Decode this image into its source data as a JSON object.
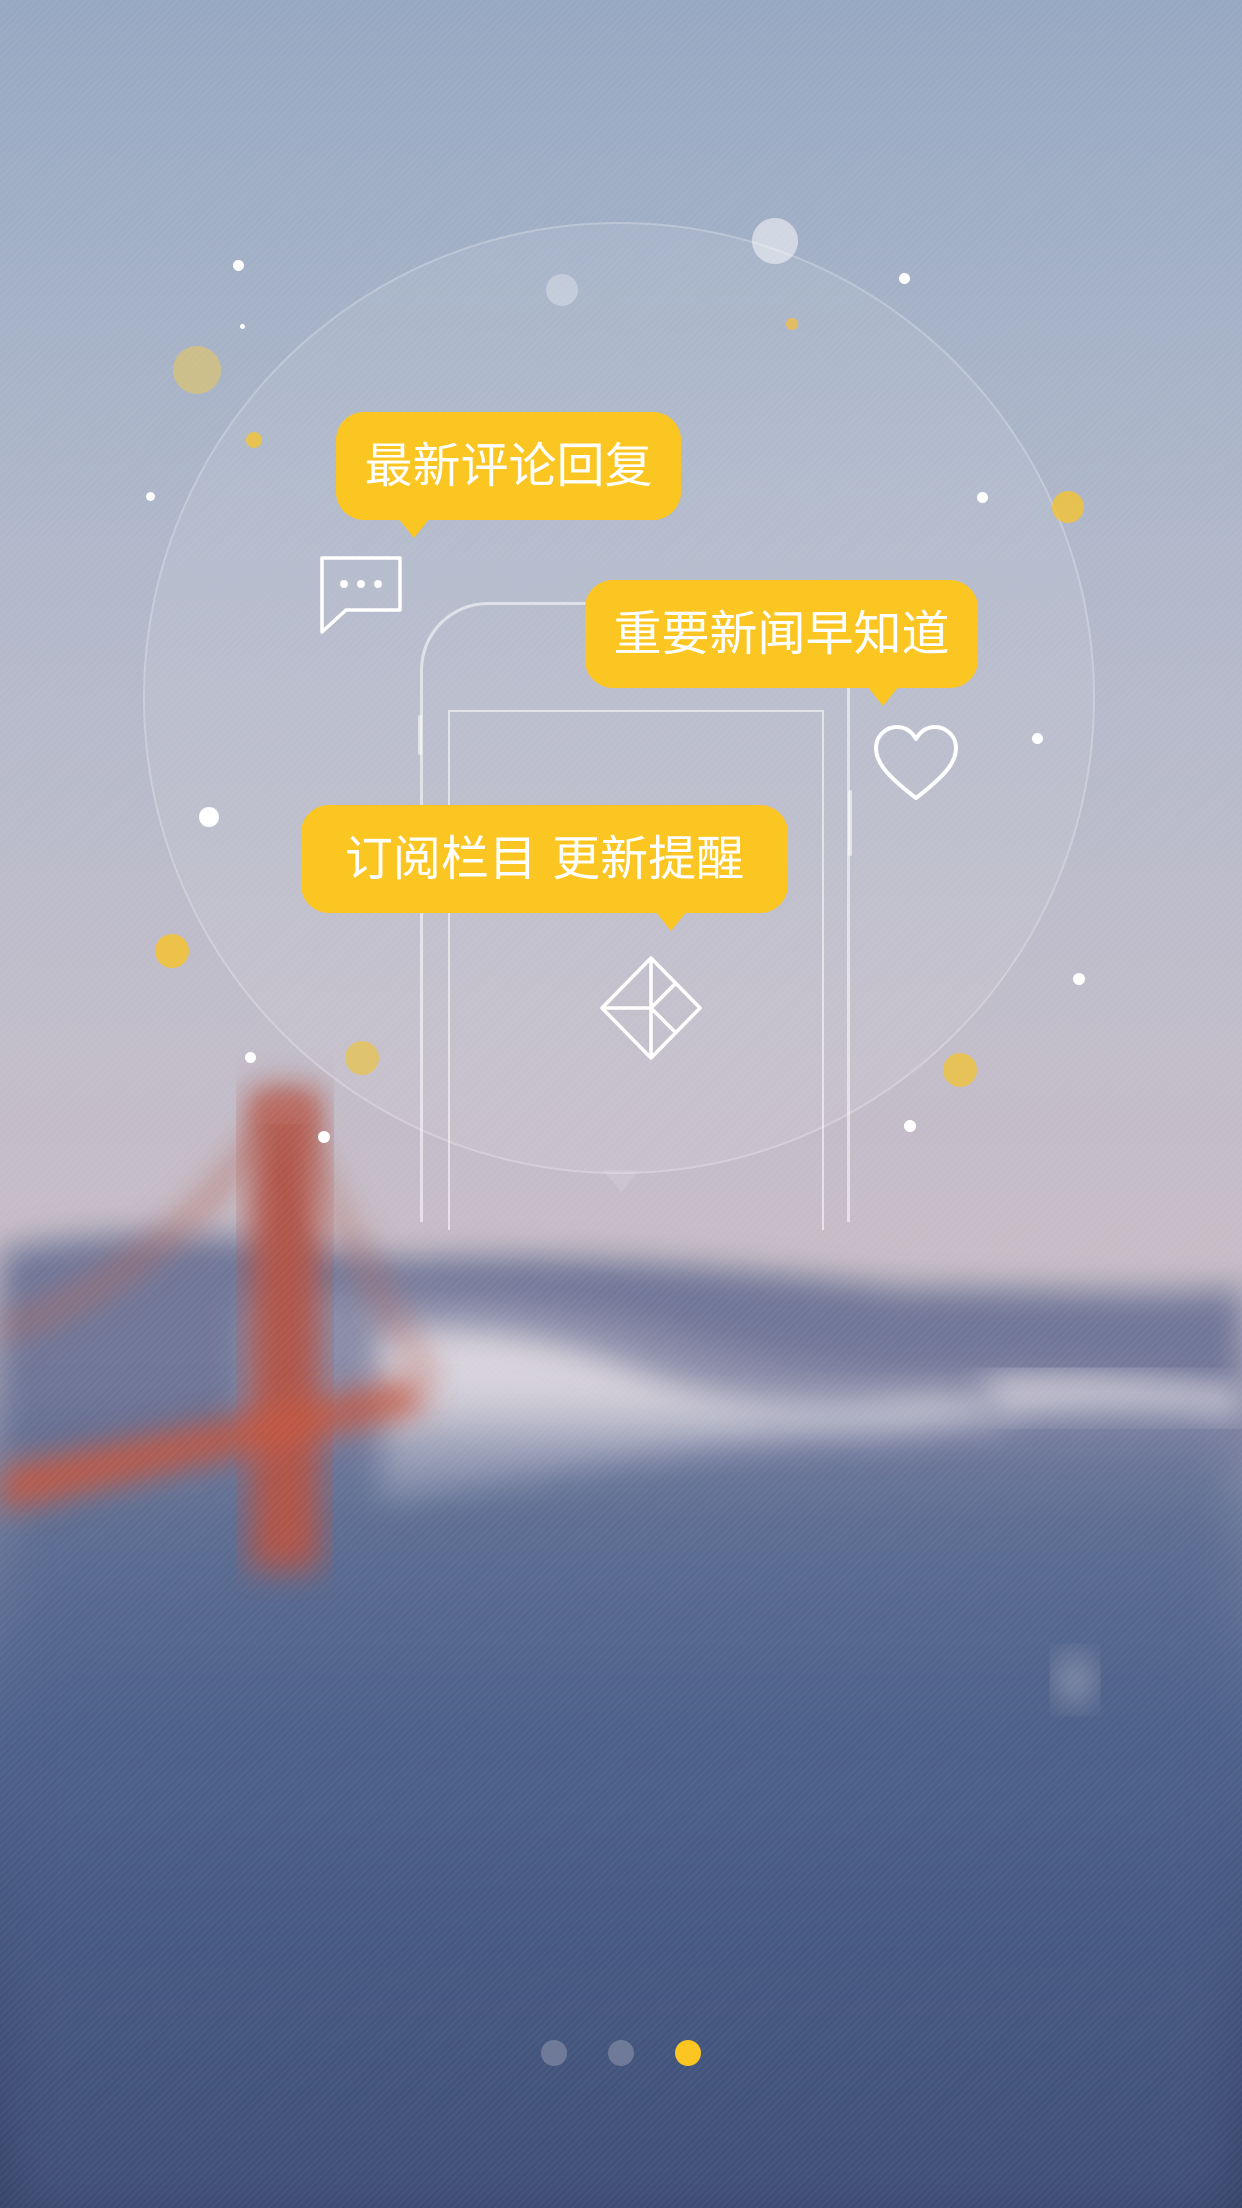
{
  "bubbles": {
    "comments": "最新评论回复",
    "news": "重要新闻早知道",
    "subscribe": "订阅栏目 更新提醒"
  },
  "icons": {
    "chat": "chat-bubble-icon",
    "heart": "heart-icon",
    "logo": "diamond-logo-icon"
  },
  "pager": {
    "pages": 3,
    "active_index": 2
  },
  "colors": {
    "accent": "#fbc522",
    "pager_inactive": "#6f7a99"
  }
}
